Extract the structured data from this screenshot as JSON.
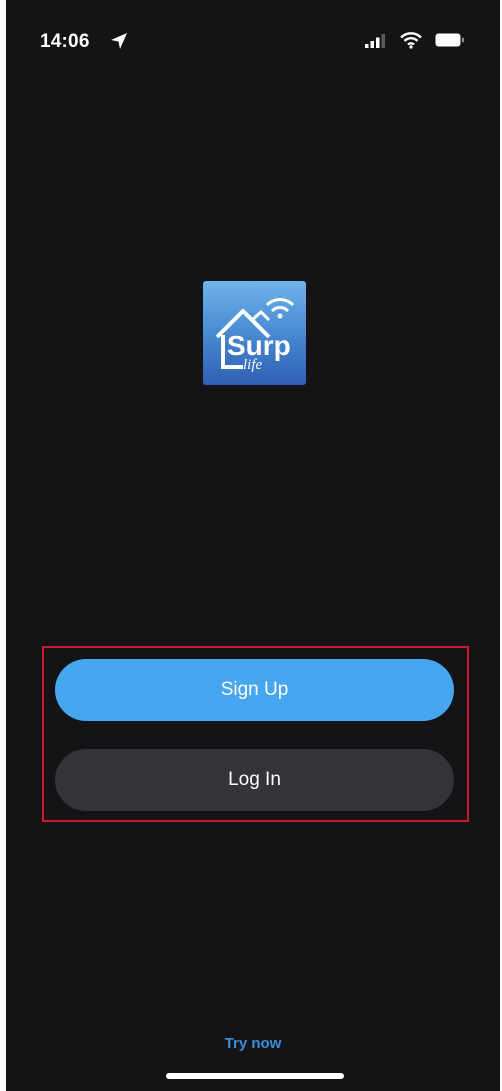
{
  "status_bar": {
    "time": "14:06",
    "icons": [
      "location-arrow-icon",
      "signal-icon",
      "wifi-icon",
      "battery-icon"
    ]
  },
  "logo": {
    "icon": "surp-life-house-wifi-logo",
    "text_main": "Surp",
    "text_sub": "life"
  },
  "auth": {
    "signup_label": "Sign Up",
    "login_label": "Log In"
  },
  "footer": {
    "try_now_label": "Try now"
  },
  "colors": {
    "background": "#141416",
    "primary": "#47a6f0",
    "secondary": "#333338",
    "link": "#3d8ddb",
    "highlight": "#c8192d"
  }
}
